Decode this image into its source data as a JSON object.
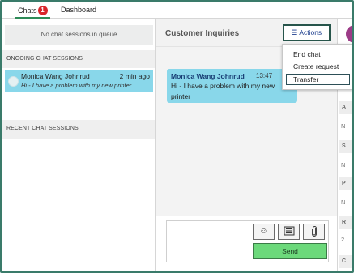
{
  "tabs": [
    {
      "label": "Chats",
      "badge": "1"
    },
    {
      "label": "Dashboard"
    }
  ],
  "queue": {
    "empty_text": "No chat sessions in queue"
  },
  "ongoing": {
    "header": "ONGOING CHAT SESSIONS",
    "sessions": [
      {
        "name": "Monica Wang Johnrud",
        "time": "2 min ago",
        "preview": "Hi - I have a problem with my new printer"
      }
    ]
  },
  "recent": {
    "header": "RECENT CHAT SESSIONS"
  },
  "chat": {
    "title": "Customer Inquiries",
    "actions_icon": "menu-icon",
    "actions_label": "☰ Actions",
    "messages": [
      {
        "sender": "Monica Wang Johnrud",
        "time": "13:47",
        "text": "Hi - I have a problem with my new printer"
      }
    ]
  },
  "actions_menu": {
    "items": [
      "End chat",
      "Create request",
      "Transfer"
    ],
    "highlighted": "Transfer"
  },
  "composer": {
    "input_value": "",
    "emoji_icon": "emoji-icon",
    "template_icon": "template-icon",
    "attach_icon": "paperclip-icon",
    "send_label": "Send"
  },
  "right_panel": {
    "stripes": [
      "A",
      "S",
      "P",
      "R",
      "C"
    ],
    "letters": [
      "N",
      "N",
      "N",
      "2"
    ]
  },
  "colors": {
    "accent_border": "#3a7b6a",
    "session_highlight": "#89d7ea",
    "send_button": "#6cd97b",
    "badge": "#d9262b",
    "avatar_right": "#9c3b87"
  }
}
